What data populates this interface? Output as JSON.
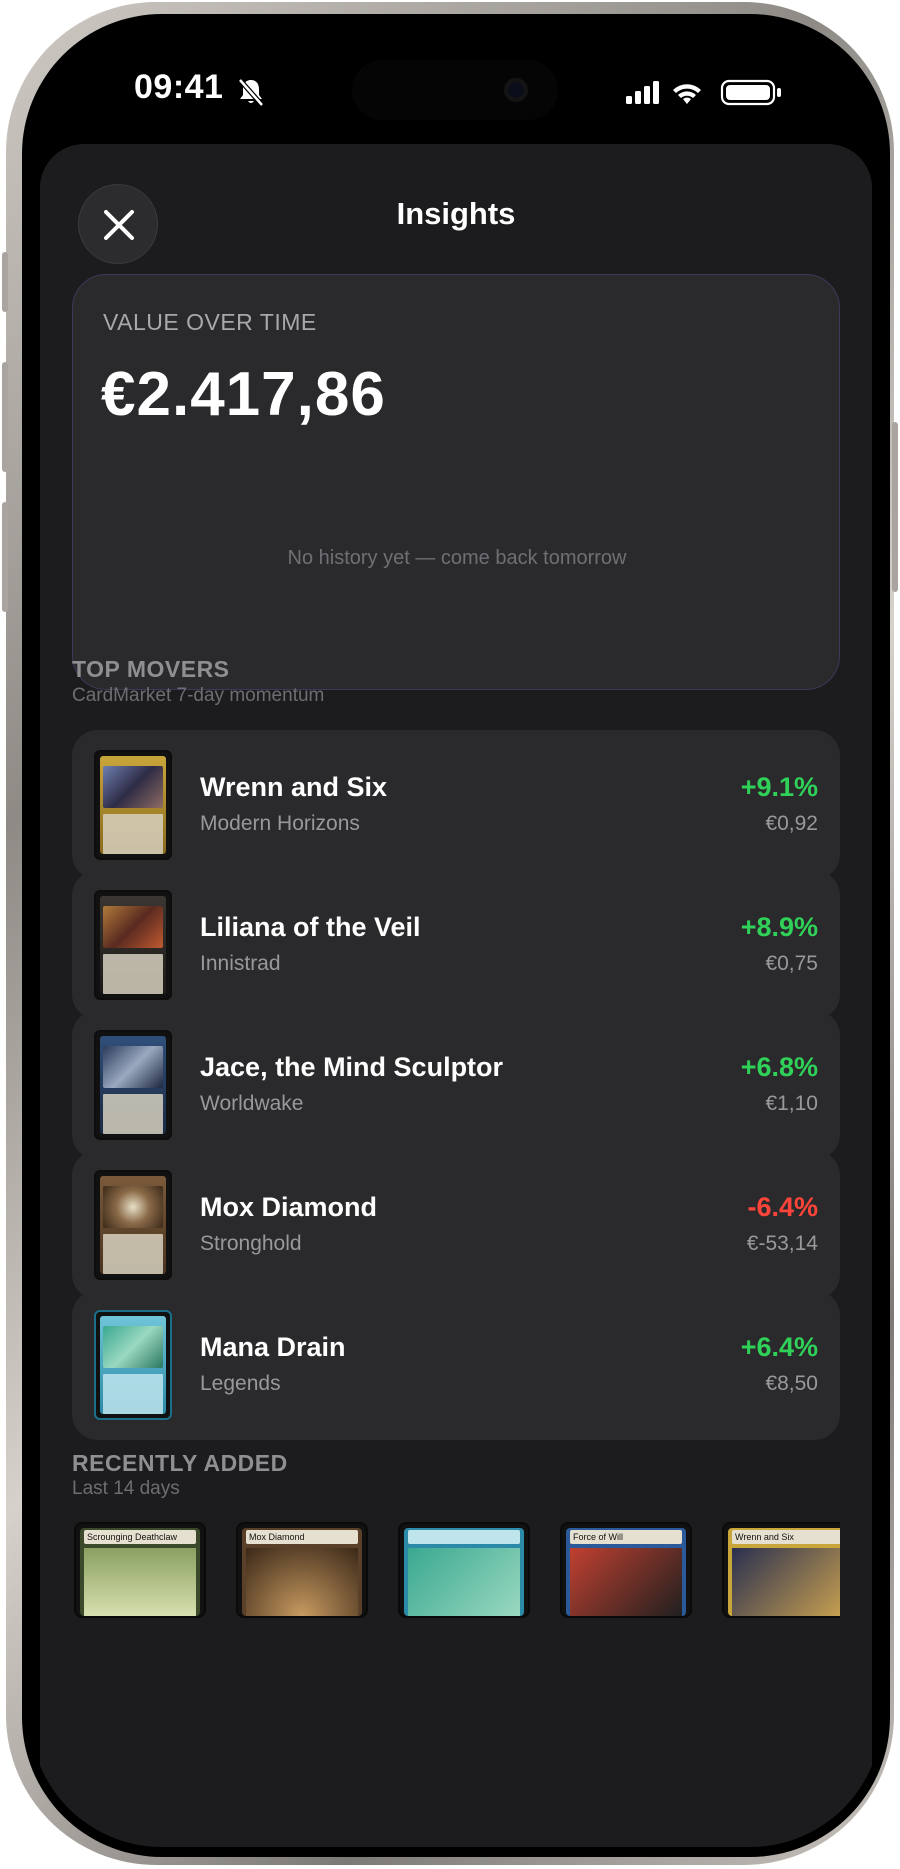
{
  "status": {
    "time": "09:41"
  },
  "sheet": {
    "title": "Insights"
  },
  "value_card": {
    "label": "VALUE OVER TIME",
    "amount": "€2.417,86",
    "empty_message": "No history yet — come back tomorrow"
  },
  "top_movers": {
    "title": "TOP MOVERS",
    "subtitle": "CardMarket 7-day momentum",
    "items": [
      {
        "name": "Wrenn and Six",
        "set": "Modern Horizons",
        "change": "+9.1%",
        "price": "€0,92",
        "trend": "up"
      },
      {
        "name": "Liliana of the Veil",
        "set": "Innistrad",
        "change": "+8.9%",
        "price": "€0,75",
        "trend": "up"
      },
      {
        "name": "Jace, the Mind Sculptor",
        "set": "Worldwake",
        "change": "+6.8%",
        "price": "€1,10",
        "trend": "up"
      },
      {
        "name": "Mox Diamond",
        "set": "Stronghold",
        "change": "-6.4%",
        "price": "€-53,14",
        "trend": "down"
      },
      {
        "name": "Mana Drain",
        "set": "Legends",
        "change": "+6.4%",
        "price": "€8,50",
        "trend": "up"
      }
    ]
  },
  "recently_added": {
    "title": "RECENTLY ADDED",
    "subtitle": "Last 14 days",
    "cards": [
      {
        "name": "Scrounging Deathclaw"
      },
      {
        "name": "Mox Diamond"
      },
      {
        "name": ""
      },
      {
        "name": "Force of Will"
      },
      {
        "name": "Wrenn and Six"
      }
    ]
  },
  "colors": {
    "positive": "#30d158",
    "negative": "#ff453a",
    "sheet_bg": "#1c1c1e",
    "card_bg": "#2a2a2c"
  }
}
